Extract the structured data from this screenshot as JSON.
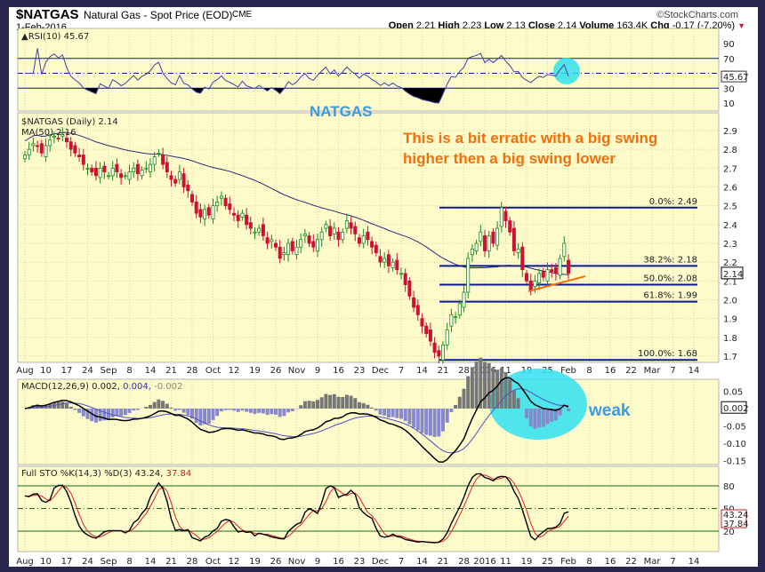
{
  "header": {
    "symbol": "$NATGAS",
    "name": "Natural Gas - Spot Price (EOD)",
    "exchange": "CME",
    "date": "1-Feb-2016",
    "copyright": "©StockCharts.com",
    "ohlc": [
      {
        "k": "Open",
        "v": "2.21"
      },
      {
        "k": "High",
        "v": "2.23"
      },
      {
        "k": "Low",
        "v": "2.13"
      },
      {
        "k": "Close",
        "v": "2.14"
      },
      {
        "k": "Volume",
        "v": "163.4K"
      },
      {
        "k": "Chg",
        "v": "-0.17 (-7.20%)"
      }
    ]
  },
  "colors": {
    "up": "#1a8a1a",
    "down": "#cc1133",
    "ma": "#2b2b7a",
    "fib": "#0a1a9a",
    "annot_blue": "#3a9ae0",
    "annot_orange": "#f07010",
    "cyan": "#30e0f0",
    "panel": "#fdfbc9"
  },
  "chart_data": {
    "type": "candlestick",
    "x_ticks": [
      "Aug",
      "10",
      "17",
      "24",
      "Sep",
      "8",
      "14",
      "21",
      "28",
      "Oct",
      "12",
      "19",
      "26",
      "Nov",
      "9",
      "16",
      "23",
      "Dec",
      "7",
      "14",
      "21",
      "28",
      "2016",
      "11",
      "19",
      "25",
      "Feb",
      "8",
      "16",
      "22",
      "Mar",
      "7",
      "14"
    ],
    "closes": [
      2.77,
      2.8,
      2.83,
      2.82,
      2.78,
      2.82,
      2.85,
      2.87,
      2.86,
      2.88,
      2.84,
      2.8,
      2.78,
      2.76,
      2.72,
      2.7,
      2.68,
      2.66,
      2.7,
      2.68,
      2.66,
      2.7,
      2.68,
      2.65,
      2.66,
      2.68,
      2.7,
      2.67,
      2.69,
      2.7,
      2.72,
      2.76,
      2.78,
      2.72,
      2.68,
      2.64,
      2.62,
      2.68,
      2.6,
      2.58,
      2.52,
      2.46,
      2.44,
      2.48,
      2.45,
      2.5,
      2.52,
      2.55,
      2.5,
      2.48,
      2.45,
      2.42,
      2.46,
      2.4,
      2.38,
      2.36,
      2.38,
      2.34,
      2.3,
      2.32,
      2.28,
      2.22,
      2.25,
      2.3,
      2.26,
      2.28,
      2.32,
      2.35,
      2.3,
      2.28,
      2.32,
      2.36,
      2.4,
      2.34,
      2.38,
      2.32,
      2.36,
      2.42,
      2.38,
      2.35,
      2.3,
      2.34,
      2.32,
      2.28,
      2.25,
      2.2,
      2.22,
      2.18,
      2.2,
      2.16,
      2.14,
      2.08,
      2.02,
      1.96,
      1.92,
      1.86,
      1.82,
      1.78,
      1.72,
      1.7,
      1.76,
      1.84,
      1.92,
      1.91,
      1.98,
      2.04,
      2.22,
      2.27,
      2.3,
      2.36,
      2.26,
      2.34,
      2.3,
      2.38,
      2.49,
      2.42,
      2.36,
      2.26,
      2.27,
      2.16,
      2.1,
      2.05,
      2.1,
      2.14,
      2.12,
      2.16,
      2.15,
      2.14,
      2.22,
      2.3,
      2.14
    ],
    "price_panel": {
      "title": "$NATGAS (Daily) 2.14",
      "ma_label": "MA(50) 2.16",
      "ylim": [
        1.65,
        2.95
      ],
      "ticks": [
        "2.9",
        "2.8",
        "2.7",
        "2.6",
        "2.5",
        "2.4",
        "2.3",
        "2.2",
        "2.1",
        "2.0",
        "1.9",
        "1.8",
        "1.7"
      ],
      "last": "2.14"
    },
    "fib": [
      {
        "level": 2.49,
        "label": "0.0%: 2.49"
      },
      {
        "level": 2.18,
        "label": "38.2%: 2.18"
      },
      {
        "level": 2.08,
        "label": "50.0%: 2.08"
      },
      {
        "level": 1.99,
        "label": "61.8%: 1.99"
      },
      {
        "level": 1.68,
        "label": "100.0%: 1.68"
      }
    ],
    "rsi_panel": {
      "title": "RSI(10) 45.67",
      "ticks": [
        "90",
        "70",
        "50",
        "30",
        "10"
      ],
      "last": "45.67"
    },
    "macd_panel": {
      "title": "MACD(12,26,9) 0.002,",
      "signal": "0.004,",
      "hist": "-0.002",
      "ticks": [
        "0.05",
        "-0.05",
        "-0.10",
        "-0.15"
      ],
      "last": "0.002"
    },
    "sto_panel": {
      "title": "Full STO %K(14,3) %D(3) 43.24,",
      "d": "37.84",
      "ticks": [
        "80",
        "50",
        "20"
      ],
      "last_k": "43.24",
      "last_d": "37.84"
    }
  },
  "annotations": {
    "natgas": "NATGAS",
    "line1": "This is a bit erratic with a big swing",
    "line2": "higher then a big swing lower",
    "weak": "weak"
  }
}
